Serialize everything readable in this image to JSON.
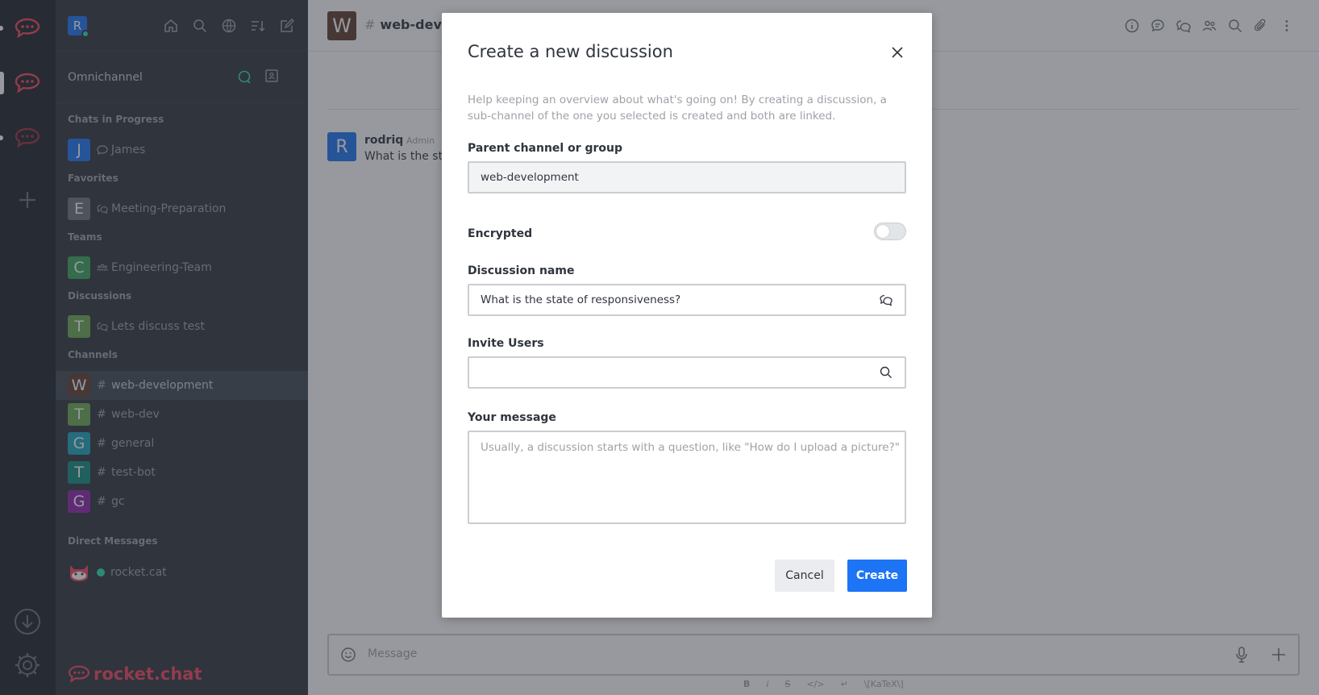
{
  "sidebar": {
    "user_initial": "R",
    "omnichannel_label": "Omnichannel",
    "sections": {
      "chats": "Chats in Progress",
      "favorites": "Favorites",
      "teams": "Teams",
      "discussions": "Discussions",
      "channels": "Channels",
      "direct": "Direct Messages"
    },
    "items": {
      "james": {
        "initial": "J",
        "name": "James",
        "color": "#1d74f5"
      },
      "meeting": {
        "initial": "E",
        "name": "Meeting-Preparation",
        "color": "#6c727a"
      },
      "engineering": {
        "initial": "C",
        "name": "Engineering-Team",
        "color": "#3ba55c"
      },
      "lets_discuss": {
        "initial": "T",
        "name": "Lets discuss test",
        "color": "#6aa84f"
      },
      "web_development": {
        "initial": "W",
        "name": "web-development",
        "color": "#5e3c2e"
      },
      "web_dev": {
        "initial": "T",
        "name": "web-dev",
        "color": "#6aa84f"
      },
      "general": {
        "initial": "G",
        "name": "general",
        "color": "#1aa4ba"
      },
      "test_bot": {
        "initial": "T",
        "name": "test-bot",
        "color": "#158a80"
      },
      "gc": {
        "initial": "G",
        "name": "gc",
        "color": "#8e24aa"
      },
      "rocket_cat": {
        "name": "rocket.cat"
      }
    },
    "logo_text": "rocket.chat"
  },
  "room": {
    "initial": "W",
    "title": "web-devel",
    "message": {
      "user_initial": "R",
      "username": "rodriq",
      "role": "Admin",
      "text": "What is the stat"
    },
    "composer_placeholder": "Message",
    "format_tools": [
      "B",
      "i",
      "S",
      "</>",
      "↵",
      "\\[KaTeX\\]"
    ]
  },
  "modal": {
    "title": "Create a new discussion",
    "description": "Help keeping an overview about what's going on! By creating a discussion, a sub-channel of the one you selected is created and both are linked.",
    "parent_label": "Parent channel or group",
    "parent_value": "web-development",
    "encrypted_label": "Encrypted",
    "encrypted": false,
    "name_label": "Discussion name",
    "name_value": "What is the state of responsiveness?",
    "invite_label": "Invite Users",
    "invite_value": "",
    "message_label": "Your message",
    "message_placeholder": "Usually, a discussion starts with a question, like \"How do I upload a picture?\"",
    "cancel_label": "Cancel",
    "create_label": "Create"
  },
  "colors": {
    "accent": "#1d74f5",
    "brand": "#f5455c",
    "sidebar_bg": "#2f343d",
    "rail_bg": "#1f2329"
  }
}
